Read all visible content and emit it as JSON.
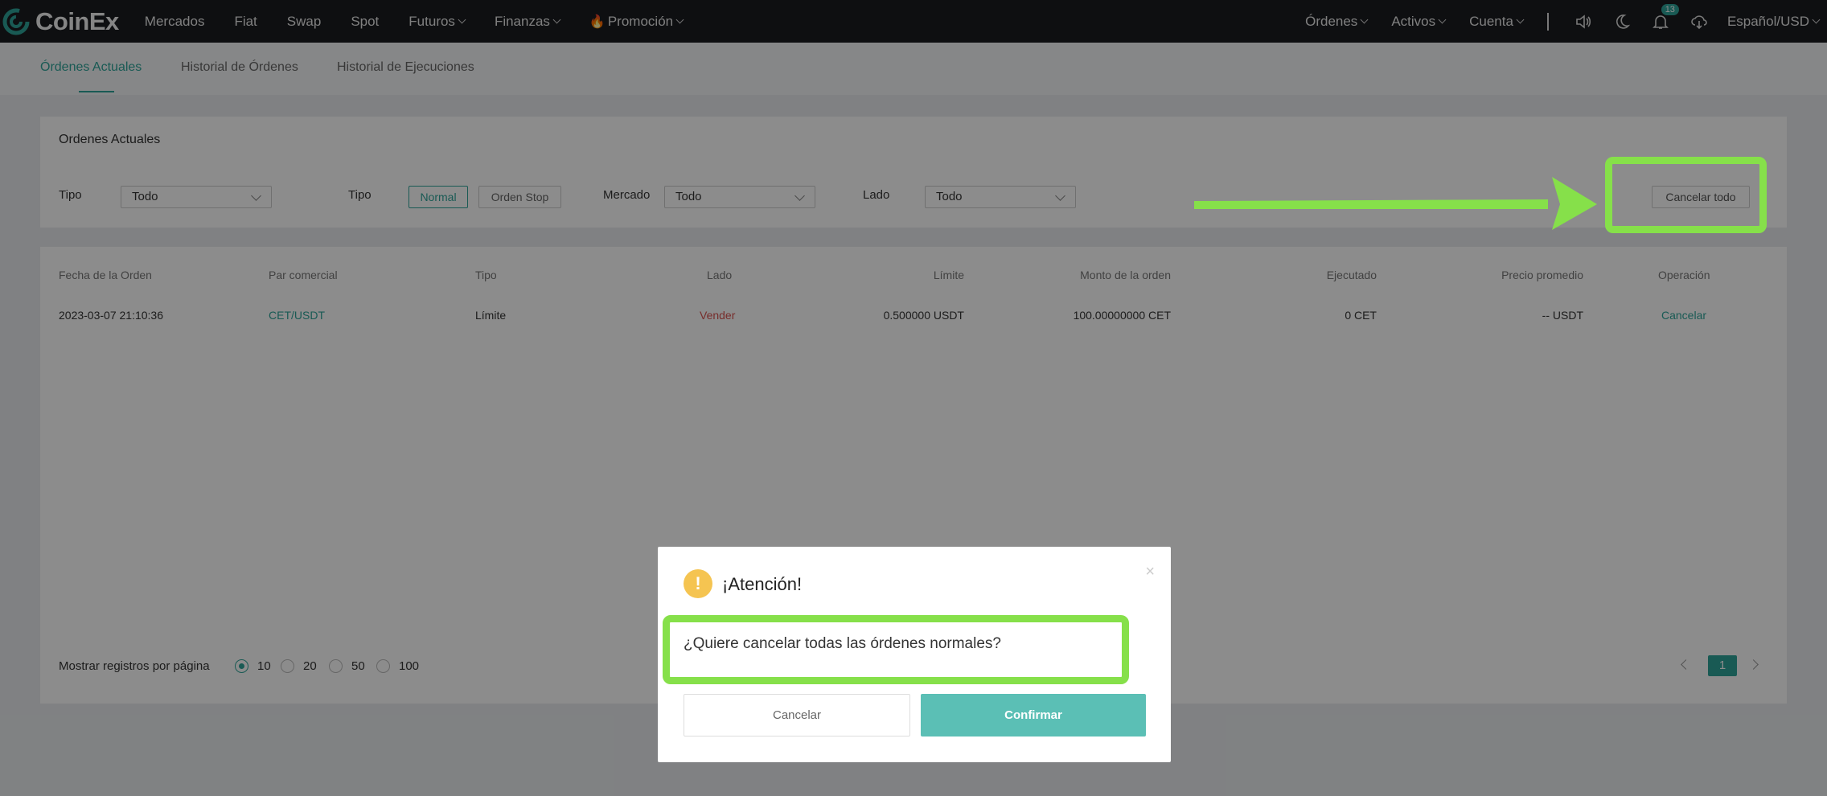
{
  "nav": {
    "brand": "CoinEx",
    "left_items": [
      {
        "label": "Mercados",
        "caret": false
      },
      {
        "label": "Fiat",
        "caret": false
      },
      {
        "label": "Swap",
        "caret": false
      },
      {
        "label": "Spot",
        "caret": false
      },
      {
        "label": "Futuros",
        "caret": true
      },
      {
        "label": "Finanzas",
        "caret": true
      },
      {
        "label": "Promoción",
        "caret": true,
        "icon": "fire-icon"
      }
    ],
    "right_items": [
      {
        "label": "Órdenes"
      },
      {
        "label": "Activos"
      },
      {
        "label": "Cuenta"
      }
    ],
    "notification_count": "13",
    "language": "Español/USD"
  },
  "subtabs": [
    "Órdenes Actuales",
    "Historial de Órdenes",
    "Historial de Ejecuciones"
  ],
  "filters": {
    "title": "Ordenes Actuales",
    "tipo1_label": "Tipo",
    "tipo1_value": "Todo",
    "tipo2_label": "Tipo",
    "tipo2_options": [
      "Normal",
      "Orden Stop"
    ],
    "mercado_label": "Mercado",
    "mercado_value": "Todo",
    "lado_label": "Lado",
    "lado_value": "Todo",
    "cancel_all": "Cancelar todo"
  },
  "table": {
    "headers": [
      "Fecha de la Orden",
      "Par comercial",
      "Tipo",
      "Lado",
      "Límite",
      "Monto de la orden",
      "Ejecutado",
      "Precio promedio",
      "Operación"
    ],
    "rows": [
      [
        "2023-03-07 21:10:36",
        "CET/USDT",
        "Límite",
        "Vender",
        "0.500000 USDT",
        "100.00000000 CET",
        "0 CET",
        "-- USDT",
        "Cancelar"
      ]
    ]
  },
  "pagination": {
    "label": "Mostrar registros por página",
    "sizes": [
      "10",
      "20",
      "50",
      "100"
    ],
    "selected": "10",
    "current_page": "1"
  },
  "modal": {
    "title": "¡Atención!",
    "message": "¿Quiere cancelar todas las órdenes normales?",
    "cancel": "Cancelar",
    "confirm": "Confirmar",
    "close": "×"
  },
  "colors": {
    "accent": "#2fa59a",
    "sell": "#d9534f",
    "highlight": "#86e04a",
    "warning": "#f5c451"
  }
}
